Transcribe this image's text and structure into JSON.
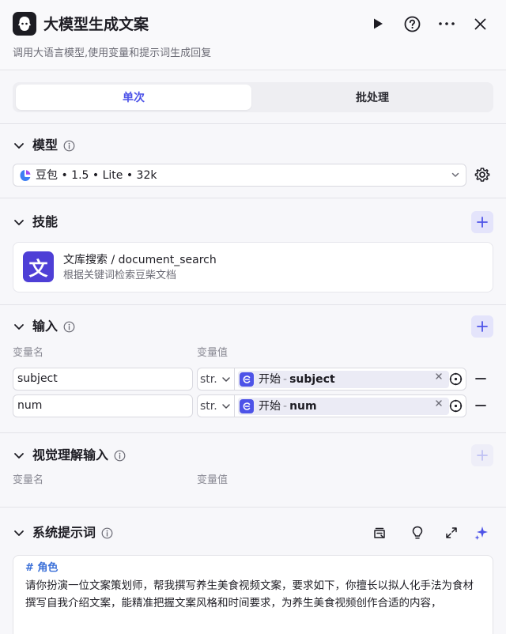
{
  "header": {
    "title": "大模型生成文案",
    "description": "调用大语言模型,使用变量和提示词生成回复",
    "icons": [
      "run-icon",
      "help-icon",
      "more-icon",
      "close-icon"
    ]
  },
  "tabs": [
    {
      "label": "单次",
      "active": true
    },
    {
      "label": "批处理",
      "active": false
    }
  ],
  "model": {
    "title": "模型",
    "selected": "豆包 • 1.5 • Lite • 32k"
  },
  "skills": {
    "title": "技能",
    "items": [
      {
        "icon_char": "文",
        "name": "文库搜索 / document_search",
        "description": "根据关键词检索豆柴文档"
      }
    ]
  },
  "inputs": {
    "title": "输入",
    "col_name": "变量名",
    "col_value": "变量值",
    "rows": [
      {
        "name": "subject",
        "type": "str.",
        "source": "开始",
        "sep": "-",
        "var": "subject"
      },
      {
        "name": "num",
        "type": "str.",
        "source": "开始",
        "sep": "-",
        "var": "num"
      }
    ]
  },
  "vision": {
    "title": "视觉理解输入",
    "col_name": "变量名",
    "col_value": "变量值"
  },
  "system_prompt": {
    "title": "系统提示词",
    "heading": "# 角色",
    "body": "请你扮演一位文案策划师，帮我撰写养生美食视频文案，要求如下，你擅长以拟人化手法为食材撰写自我介绍文案，能精准把握文案风格和时间要求，为养生美食视频创作合适的内容，"
  },
  "colors": {
    "accent": "#4d53e8",
    "skill_icon_bg": "#4e3fd6",
    "prompt_heading": "#3a6fd8"
  }
}
